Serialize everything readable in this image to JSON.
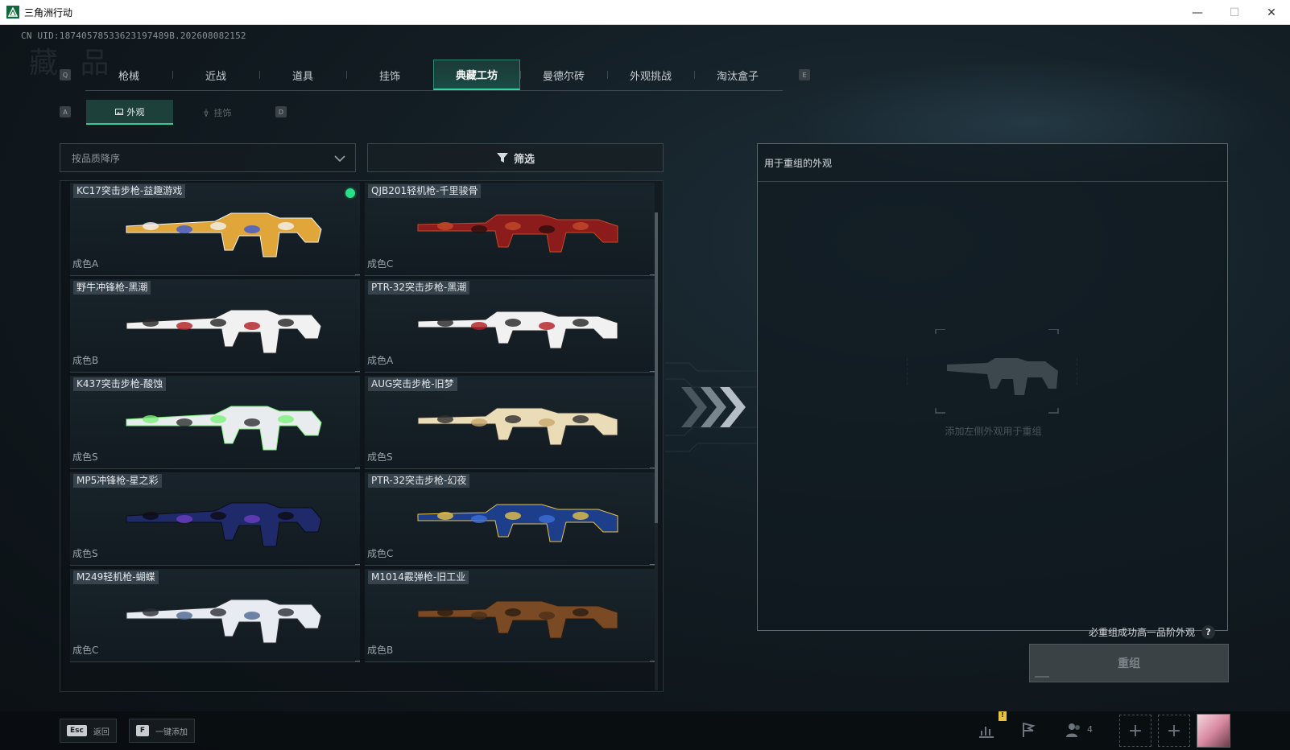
{
  "window": {
    "title": "三角洲行动",
    "minimize": "—",
    "maximize": "☐",
    "close": "✕"
  },
  "uid": "CN UID:18740578533623197489B.202608082152",
  "background_title": "藏 品",
  "tabs": {
    "prev_key": "Q",
    "next_key": "E",
    "items": [
      {
        "label": "枪械"
      },
      {
        "label": "近战"
      },
      {
        "label": "道具"
      },
      {
        "label": "挂饰"
      },
      {
        "label": "典藏工坊",
        "active": true
      },
      {
        "label": "曼德尔砖"
      },
      {
        "label": "外观挑战"
      },
      {
        "label": "淘汰盒子"
      }
    ]
  },
  "subtabs": {
    "prev_key": "A",
    "next_key": "D",
    "items": [
      {
        "label": "外观",
        "icon": "image-icon",
        "active": true
      },
      {
        "label": "挂饰",
        "icon": "charm-icon"
      }
    ]
  },
  "sort": {
    "value": "按品质降序",
    "icon": "chevron-down-icon"
  },
  "filter": {
    "label": "筛选",
    "icon": "filter-icon"
  },
  "skins": [
    {
      "name": "KC17突击步枪-益趣游戏",
      "grade": "成色A",
      "selected": true,
      "palette": [
        "#e1a63a",
        "#3b5bd6",
        "#f2f2f2"
      ]
    },
    {
      "name": "QJB201轻机枪-千里骏骨",
      "grade": "成色C",
      "palette": [
        "#8c1c1c",
        "#2a0e0e",
        "#c24a2a"
      ]
    },
    {
      "name": "野牛冲锋枪-黑潮",
      "grade": "成色B",
      "palette": [
        "#f1f1f1",
        "#b31d22",
        "#262626"
      ]
    },
    {
      "name": "PTR-32突击步枪-黑潮",
      "grade": "成色A",
      "palette": [
        "#f1f1f1",
        "#b31d22",
        "#262626"
      ]
    },
    {
      "name": "K437突击步枪-酸蚀",
      "grade": "成色S",
      "palette": [
        "#e9ecef",
        "#2d2f31",
        "#7cf07a"
      ]
    },
    {
      "name": "AUG突击步枪-旧梦",
      "grade": "成色S",
      "palette": [
        "#e9dcb7",
        "#c9a86d",
        "#2d2d2d"
      ]
    },
    {
      "name": "MP5冲锋枪-星之彩",
      "grade": "成色S",
      "palette": [
        "#1e2a6a",
        "#6a3fc2",
        "#0d0d12"
      ]
    },
    {
      "name": "PTR-32突击步枪-幻夜",
      "grade": "成色C",
      "palette": [
        "#1d3e8a",
        "#3c6fd8",
        "#e6c24a"
      ]
    },
    {
      "name": "M249轻机枪-蝴蝶",
      "grade": "成色C",
      "palette": [
        "#e8ecf2",
        "#4d6690",
        "#2a2e34"
      ]
    },
    {
      "name": "M1014霰弹枪-旧工业",
      "grade": "成色B",
      "palette": [
        "#7a4a25",
        "#4c2e17",
        "#2b1d12"
      ]
    }
  ],
  "reconstruct": {
    "header": "用于重组的外观",
    "hint": "添加左侧外观用于重组",
    "note": "必重组成功高一品阶外观",
    "help": "?",
    "button": "重组"
  },
  "bottom": {
    "esc_key": "Esc",
    "esc_label": "返回",
    "add_key": "F",
    "add_label": "一键添加",
    "notify": "!",
    "friends_count": "4",
    "plus": "+"
  },
  "colors": {
    "accent": "#2fd4a0",
    "active_tab_bg": "#1a4a44",
    "selected_dot": "#28e08a"
  }
}
